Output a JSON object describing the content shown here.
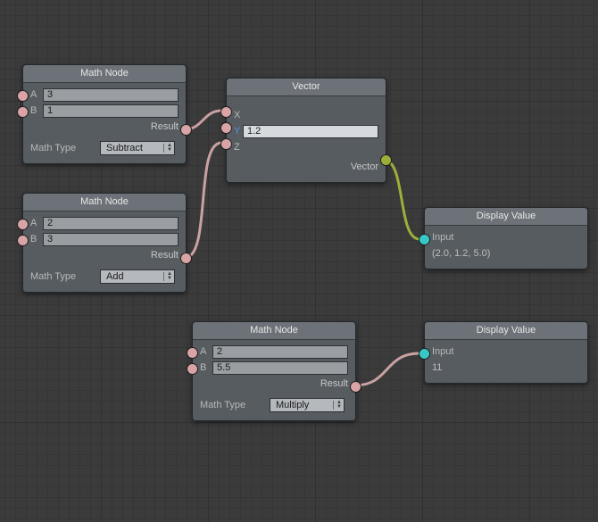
{
  "mathNode1": {
    "title": "Math Node",
    "inputs": [
      {
        "label": "A",
        "value": "3"
      },
      {
        "label": "B",
        "value": "1"
      }
    ],
    "outputLabel": "Result",
    "mathTypeLabel": "Math Type",
    "mathType": "Subtract"
  },
  "mathNode2": {
    "title": "Math Node",
    "inputs": [
      {
        "label": "A",
        "value": "2"
      },
      {
        "label": "B",
        "value": "3"
      }
    ],
    "outputLabel": "Result",
    "mathTypeLabel": "Math Type",
    "mathType": "Add"
  },
  "mathNode3": {
    "title": "Math Node",
    "inputs": [
      {
        "label": "A",
        "value": "2"
      },
      {
        "label": "B",
        "value": "5.5"
      }
    ],
    "outputLabel": "Result",
    "mathTypeLabel": "Math Type",
    "mathType": "Multiply"
  },
  "vectorNode": {
    "title": "Vector",
    "inputs": [
      {
        "label": "X"
      },
      {
        "label": "Y",
        "value": "1.2"
      },
      {
        "label": "Z"
      }
    ],
    "outputLabel": "Vector"
  },
  "displayNode1": {
    "title": "Display Value",
    "inputLabel": "Input",
    "value": "(2.0, 1.2, 5.0)"
  },
  "displayNode2": {
    "title": "Display Value",
    "inputLabel": "Input",
    "value": "11"
  },
  "colors": {
    "floatPort": "#d9a4a6",
    "vectorPort": "#9fae3a",
    "anyPort": "#37c7c7",
    "nodeHeader": "#6c7277",
    "nodeBody": "#575c61",
    "canvasBg": "#3b3b3b"
  }
}
